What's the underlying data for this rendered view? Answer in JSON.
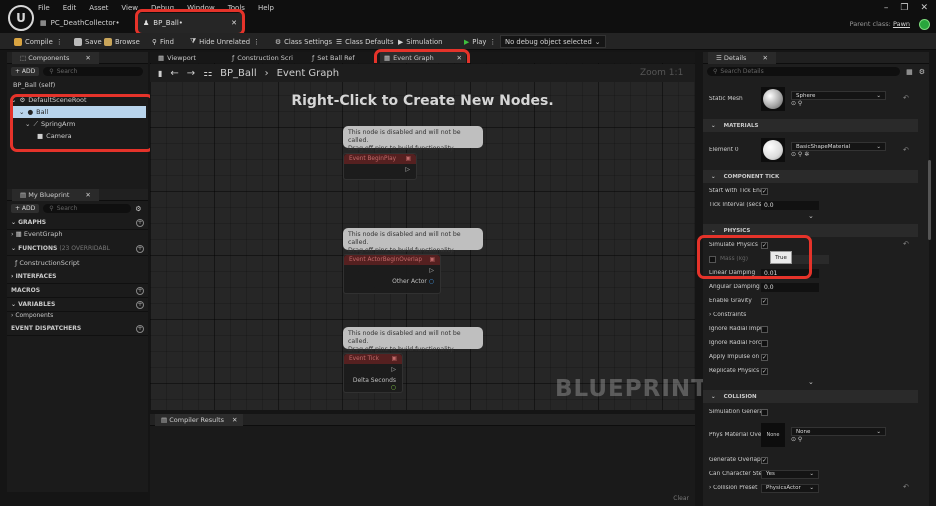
{
  "menu": [
    "File",
    "Edit",
    "Asset",
    "View",
    "Debug",
    "Window",
    "Tools",
    "Help"
  ],
  "project_tab": "PC_DeathCollector•",
  "asset_tab": "BP_Ball•",
  "parent_class": {
    "label": "Parent class:",
    "value": "Pawn"
  },
  "toolbar": {
    "compile": "Compile",
    "save": "Save",
    "browse": "Browse",
    "find": "Find",
    "hide_unrelated": "Hide Unrelated",
    "class_settings": "Class Settings",
    "class_defaults": "Class Defaults",
    "simulation": "Simulation",
    "play": "Play",
    "debug_filter": "No debug object selected"
  },
  "components": {
    "tab": "Components",
    "add": "+ ADD",
    "search_placeholder": "Search",
    "self": "BP_Ball (self)",
    "tree": [
      "DefaultSceneRoot",
      "Ball",
      "SpringArm",
      "Camera"
    ]
  },
  "my_blueprint": {
    "tab": "My Blueprint",
    "add": "+ ADD",
    "search_placeholder": "Search",
    "graphs": "GRAPHS",
    "event_graph": "EventGraph",
    "functions": "FUNCTIONS",
    "functions_count": "(23 OVERRIDABL",
    "construction_script": "ConstructionScript",
    "interfaces": "INTERFACES",
    "macros": "MACROS",
    "variables": "VARIABLES",
    "var_components": "Components",
    "event_dispatchers": "EVENT DISPATCHERS"
  },
  "doc_tabs": [
    "Viewport",
    "Construction Scri",
    "Set Ball Ref",
    "Event Graph"
  ],
  "breadcrumb": {
    "bp": "BP_Ball",
    "graph": "Event Graph"
  },
  "graph": {
    "hint": "Right-Click to Create New Nodes.",
    "zoom": "Zoom 1:1",
    "watermark": "BLUEPRINT",
    "comment_line1": "This node is disabled and will not be called.",
    "comment_line2": "Drag off pins to build functionality.",
    "nodes": [
      {
        "title": "Event BeginPlay",
        "pin": ""
      },
      {
        "title": "Event ActorBeginOverlap",
        "pin": "Other Actor"
      },
      {
        "title": "Event Tick",
        "pin": "Delta Seconds"
      }
    ]
  },
  "compiler": {
    "tab": "Compiler Results",
    "clear": "Clear"
  },
  "details": {
    "tab": "Details",
    "search_placeholder": "Search Details",
    "static_mesh_label": "Static Mesh",
    "static_mesh_value": "Sphere",
    "materials": "MATERIALS",
    "element0_label": "Element 0",
    "element0_value": "BasicShapeMaterial",
    "component_tick": "COMPONENT TICK",
    "start_tick": "Start with Tick Enal",
    "tick_interval": "Tick Interval (secs)",
    "tick_interval_value": "0.0",
    "physics": "PHYSICS",
    "simulate_physics": "Simulate Physics",
    "tooltip": "True",
    "mass": "Mass (kg)",
    "linear_damping": "Linear Damping",
    "linear_damping_value": "0.01",
    "angular_damping": "Angular Damping",
    "angular_damping_value": "0.0",
    "enable_gravity": "Enable Gravity",
    "constraints": "Constraints",
    "ignore_radial_impulse": "Ignore Radial Impul",
    "ignore_radial_force": "Ignore Radial Force",
    "apply_impulse": "Apply Impulse on D",
    "replicate_physics": "Replicate Physics t",
    "collision": "COLLISION",
    "sim_gen": "Simulation Generat",
    "phys_mat": "Phys Material Over",
    "phys_mat_thumb": "None",
    "phys_mat_value": "None",
    "gen_overlap": "Generate Overlap E",
    "can_step": "Can Character Step",
    "can_step_value": "Yes",
    "collision_presets": "Collision Preset",
    "collision_presets_value": "PhysicsActor"
  },
  "colors": {
    "highlight": "#e5332a",
    "selection": "#b8d4ec",
    "play": "#3fbf3f"
  }
}
